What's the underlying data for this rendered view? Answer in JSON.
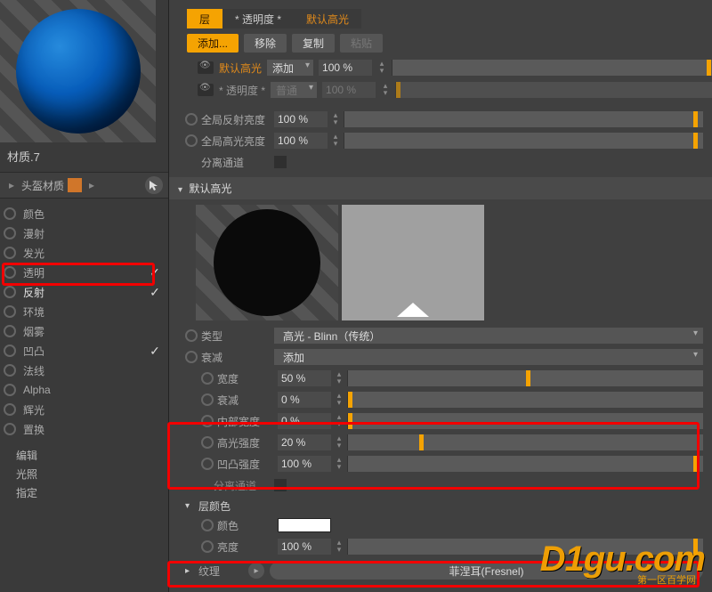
{
  "left": {
    "material_name": "材质.7",
    "object_name": "头盔材质",
    "edit_label": "编辑",
    "light_label": "光照",
    "assign_label": "指定",
    "channels": [
      {
        "label": "颜色",
        "checked": false
      },
      {
        "label": "漫射",
        "checked": false
      },
      {
        "label": "发光",
        "checked": false
      },
      {
        "label": "透明",
        "checked": true
      },
      {
        "label": "反射",
        "checked": true,
        "active": true
      },
      {
        "label": "环境",
        "checked": false
      },
      {
        "label": "烟雾",
        "checked": false
      },
      {
        "label": "凹凸",
        "checked": true
      },
      {
        "label": "法线",
        "checked": false
      },
      {
        "label": "Alpha",
        "checked": false
      },
      {
        "label": "辉光",
        "checked": false
      },
      {
        "label": "置换",
        "checked": false
      }
    ]
  },
  "tabs": {
    "layer": "层",
    "trans": "* 透明度 *",
    "spec": "默认高光"
  },
  "buttons": {
    "add": "添加...",
    "remove": "移除",
    "copy": "复制",
    "paste": "粘贴"
  },
  "layers": {
    "spec": {
      "name": "默认高光",
      "mode": "添加",
      "value": "100 %",
      "knob": 100
    },
    "trans": {
      "name": "* 透明度 *",
      "mode": "普通",
      "value": "100 %",
      "knob": 0
    }
  },
  "globals": {
    "refl": {
      "label": "全局反射亮度",
      "value": "100 %",
      "knob": 98
    },
    "spec": {
      "label": "全局高光亮度",
      "value": "100 %",
      "knob": 98
    },
    "sep": "分离通道"
  },
  "section": {
    "title": "默认高光"
  },
  "params": {
    "type": {
      "label": "类型",
      "value": "高光 - Blinn（传统）"
    },
    "atten": {
      "label": "衰减",
      "value": "添加"
    },
    "width": {
      "label": "宽度",
      "value": "50 %",
      "knob": 50
    },
    "falloff": {
      "label": "衰减",
      "value": "0 %",
      "knob": 0
    },
    "inner": {
      "label": "内部宽度",
      "value": "0 %",
      "knob": 0
    },
    "specint": {
      "label": "高光强度",
      "value": "20 %",
      "knob": 20
    },
    "bumpint": {
      "label": "凹凸强度",
      "value": "100 %",
      "knob": 98
    },
    "sep2": "分离通道"
  },
  "layercolor": {
    "title": "层颜色",
    "color_label": "颜色",
    "bright": {
      "label": "亮度",
      "value": "100 %",
      "knob": 98
    },
    "tex_label": "纹理",
    "tex_value": "菲涅耳(Fresnel)"
  },
  "watermark": {
    "main": "D1gu.com",
    "sub": "第一区百学网"
  }
}
